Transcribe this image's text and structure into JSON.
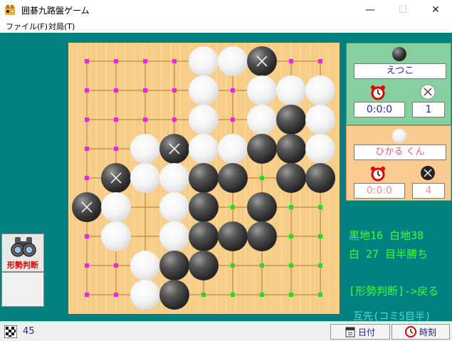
{
  "window": {
    "title": "囲碁九路盤ゲーム",
    "minimize": "—",
    "maximize": "☐",
    "close": "✕"
  },
  "menu": {
    "items": [
      "ファイル(F)",
      "対局(T)"
    ]
  },
  "board": {
    "size": 9,
    "stones": [
      {
        "c": "white",
        "x": 4,
        "y": 0
      },
      {
        "c": "white",
        "x": 5,
        "y": 0
      },
      {
        "c": "black",
        "x": 6,
        "y": 0,
        "dead": true
      },
      {
        "c": "white",
        "x": 4,
        "y": 1
      },
      {
        "c": "white",
        "x": 6,
        "y": 1
      },
      {
        "c": "white",
        "x": 7,
        "y": 1
      },
      {
        "c": "white",
        "x": 8,
        "y": 1
      },
      {
        "c": "white",
        "x": 4,
        "y": 2
      },
      {
        "c": "white",
        "x": 6,
        "y": 2
      },
      {
        "c": "black",
        "x": 7,
        "y": 2
      },
      {
        "c": "white",
        "x": 8,
        "y": 2
      },
      {
        "c": "white",
        "x": 2,
        "y": 3
      },
      {
        "c": "black",
        "x": 3,
        "y": 3,
        "dead": true
      },
      {
        "c": "white",
        "x": 4,
        "y": 3
      },
      {
        "c": "white",
        "x": 5,
        "y": 3
      },
      {
        "c": "black",
        "x": 6,
        "y": 3
      },
      {
        "c": "black",
        "x": 7,
        "y": 3
      },
      {
        "c": "white",
        "x": 8,
        "y": 3
      },
      {
        "c": "black",
        "x": 1,
        "y": 4,
        "dead": true
      },
      {
        "c": "white",
        "x": 2,
        "y": 4
      },
      {
        "c": "white",
        "x": 3,
        "y": 4
      },
      {
        "c": "black",
        "x": 4,
        "y": 4
      },
      {
        "c": "black",
        "x": 5,
        "y": 4
      },
      {
        "c": "black",
        "x": 7,
        "y": 4
      },
      {
        "c": "black",
        "x": 8,
        "y": 4
      },
      {
        "c": "black",
        "x": 0,
        "y": 5,
        "dead": true
      },
      {
        "c": "white",
        "x": 1,
        "y": 5
      },
      {
        "c": "white",
        "x": 3,
        "y": 5
      },
      {
        "c": "black",
        "x": 4,
        "y": 5
      },
      {
        "c": "black",
        "x": 6,
        "y": 5
      },
      {
        "c": "white",
        "x": 1,
        "y": 6
      },
      {
        "c": "white",
        "x": 3,
        "y": 6
      },
      {
        "c": "black",
        "x": 4,
        "y": 6
      },
      {
        "c": "black",
        "x": 5,
        "y": 6
      },
      {
        "c": "black",
        "x": 6,
        "y": 6
      },
      {
        "c": "white",
        "x": 2,
        "y": 7
      },
      {
        "c": "black",
        "x": 3,
        "y": 7
      },
      {
        "c": "black",
        "x": 4,
        "y": 7
      },
      {
        "c": "white",
        "x": 2,
        "y": 8
      },
      {
        "c": "black",
        "x": 3,
        "y": 8
      }
    ],
    "territory": [
      {
        "c": "white",
        "x": 0,
        "y": 0
      },
      {
        "c": "white",
        "x": 1,
        "y": 0
      },
      {
        "c": "white",
        "x": 2,
        "y": 0
      },
      {
        "c": "white",
        "x": 3,
        "y": 0
      },
      {
        "c": "white",
        "x": 7,
        "y": 0
      },
      {
        "c": "white",
        "x": 8,
        "y": 0
      },
      {
        "c": "white",
        "x": 0,
        "y": 1
      },
      {
        "c": "white",
        "x": 1,
        "y": 1
      },
      {
        "c": "white",
        "x": 2,
        "y": 1
      },
      {
        "c": "white",
        "x": 3,
        "y": 1
      },
      {
        "c": "white",
        "x": 5,
        "y": 1
      },
      {
        "c": "white",
        "x": 0,
        "y": 2
      },
      {
        "c": "white",
        "x": 1,
        "y": 2
      },
      {
        "c": "white",
        "x": 2,
        "y": 2
      },
      {
        "c": "white",
        "x": 3,
        "y": 2
      },
      {
        "c": "white",
        "x": 5,
        "y": 2
      },
      {
        "c": "white",
        "x": 0,
        "y": 3
      },
      {
        "c": "white",
        "x": 1,
        "y": 3
      },
      {
        "c": "white",
        "x": 0,
        "y": 4
      },
      {
        "c": "white",
        "x": 0,
        "y": 6
      },
      {
        "c": "white",
        "x": 0,
        "y": 7
      },
      {
        "c": "white",
        "x": 1,
        "y": 7
      },
      {
        "c": "white",
        "x": 0,
        "y": 8
      },
      {
        "c": "white",
        "x": 1,
        "y": 8
      },
      {
        "c": "black",
        "x": 6,
        "y": 4
      },
      {
        "c": "black",
        "x": 5,
        "y": 5
      },
      {
        "c": "black",
        "x": 7,
        "y": 5
      },
      {
        "c": "black",
        "x": 8,
        "y": 5
      },
      {
        "c": "black",
        "x": 7,
        "y": 6
      },
      {
        "c": "black",
        "x": 8,
        "y": 6
      },
      {
        "c": "black",
        "x": 5,
        "y": 7
      },
      {
        "c": "black",
        "x": 6,
        "y": 7
      },
      {
        "c": "black",
        "x": 7,
        "y": 7
      },
      {
        "c": "black",
        "x": 8,
        "y": 7
      },
      {
        "c": "black",
        "x": 4,
        "y": 8
      },
      {
        "c": "black",
        "x": 5,
        "y": 8
      },
      {
        "c": "black",
        "x": 6,
        "y": 8
      },
      {
        "c": "black",
        "x": 7,
        "y": 8
      },
      {
        "c": "black",
        "x": 8,
        "y": 8
      }
    ]
  },
  "colors": {
    "client": "#00807f",
    "board": "#f8cf8a",
    "grid": "#b07a30",
    "black_territory": "#22dd22",
    "white_territory": "#ee22ee",
    "score_text": "#3cff3c",
    "komi_text": "#36e6e0"
  },
  "black_player": {
    "name": "えつこ",
    "time": "0:0:0",
    "captures": "1",
    "name_color": "#1a2aa0",
    "box_color": "#1a2aa0"
  },
  "white_player": {
    "name": "ひかる くん",
    "time": "0:0:0",
    "captures": "4",
    "name_color": "#e06080",
    "box_color": "#e890a0"
  },
  "score": {
    "line1": "黒地16 白地38",
    "line2": "白 27 目半勝ち",
    "hint": "[形勢判断]->戻る"
  },
  "komi": "互先(コミ5目半)",
  "judge_button": {
    "label": "形勢判断",
    "icon": "binoculars-icon"
  },
  "status": {
    "move_number": "45",
    "date_label": "日付",
    "time_label": "時刻"
  }
}
